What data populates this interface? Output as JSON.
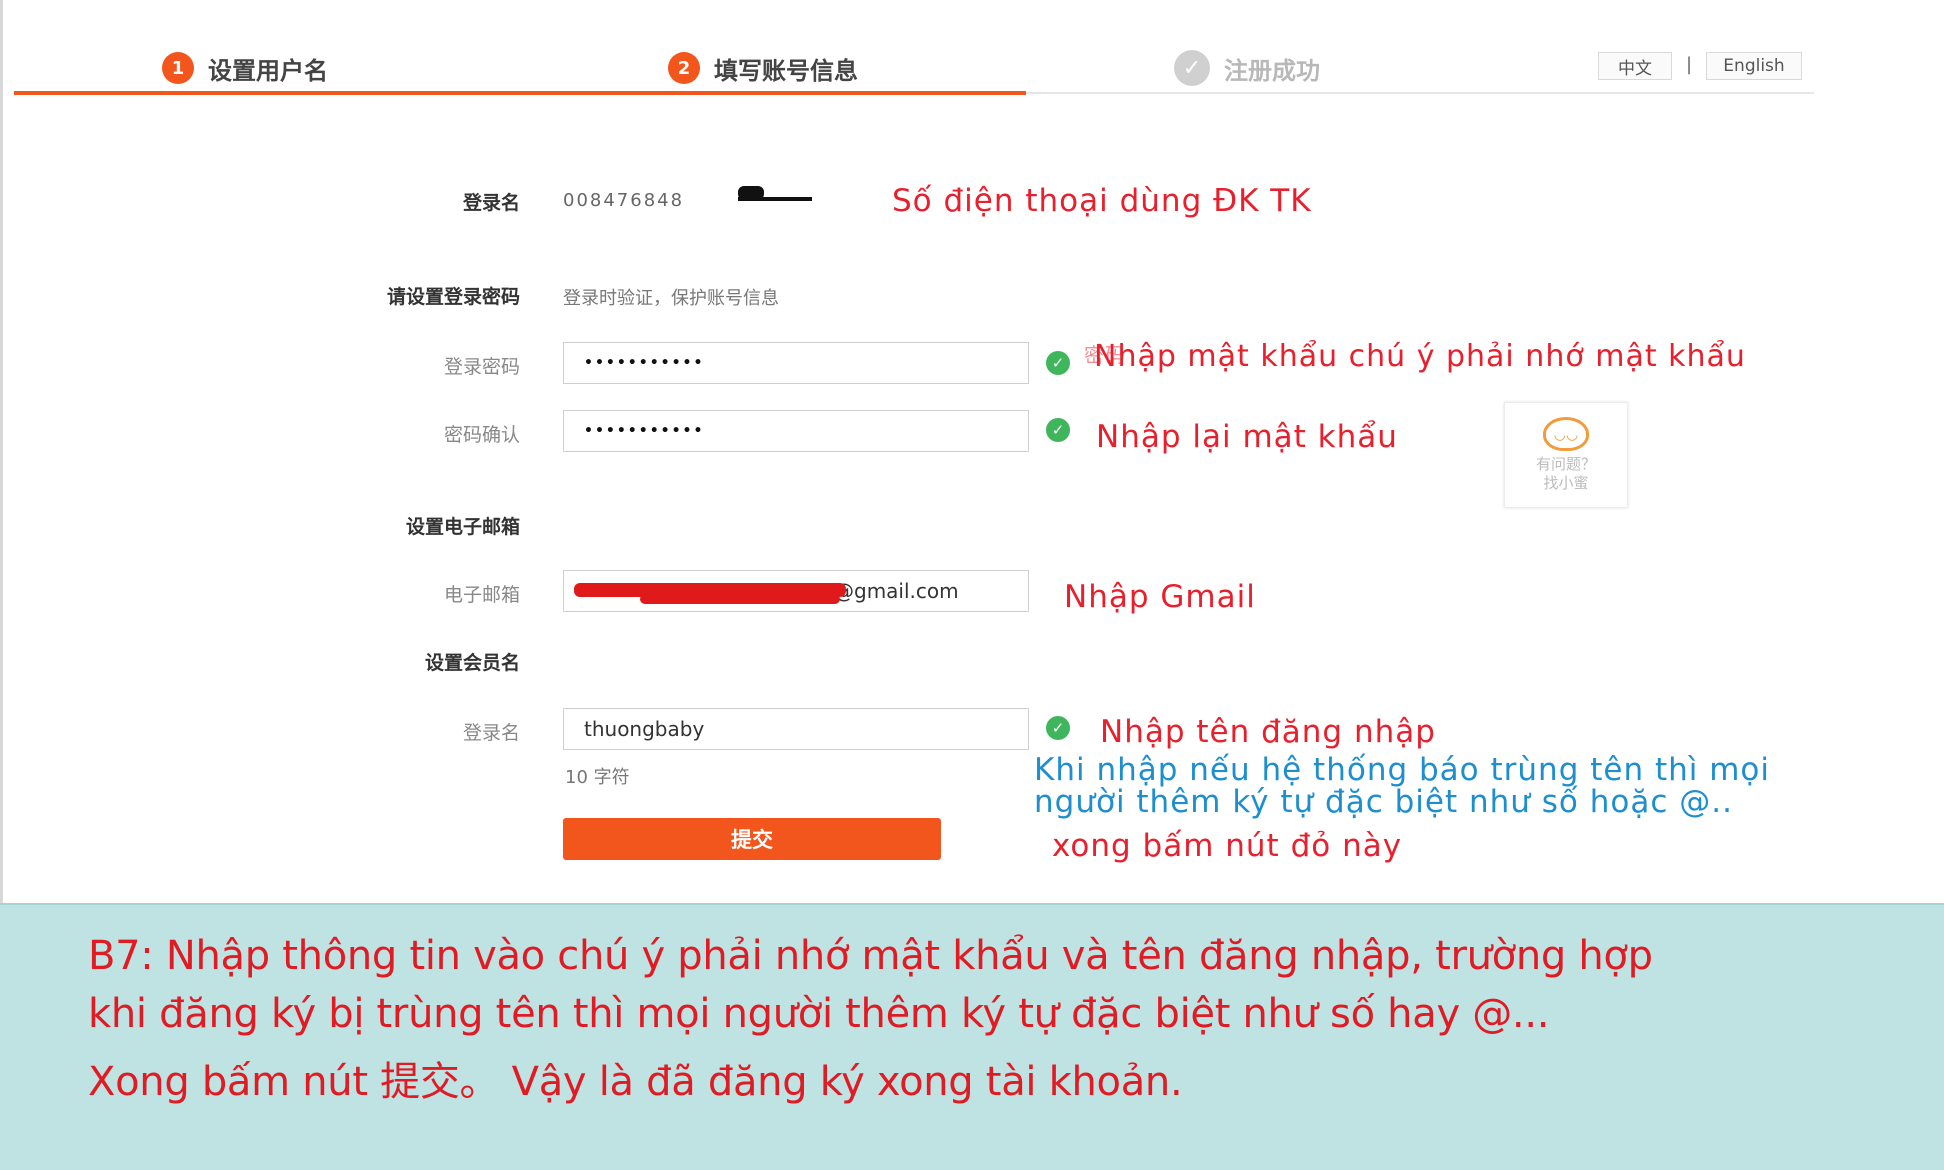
{
  "steps": [
    {
      "num": "1",
      "label": "设置用户名"
    },
    {
      "num": "2",
      "label": "填写账号信息"
    },
    {
      "label": "注册成功"
    }
  ],
  "lang": {
    "zh": "中文",
    "sep": "|",
    "en": "English"
  },
  "form": {
    "login_label": "登录名",
    "login_value": "008476848",
    "password_section": "请设置登录密码",
    "password_hint": "登录时验证，保护账号信息",
    "password_label": "登录密码",
    "password_value": "•••••••••••",
    "confirm_label": "密码确认",
    "confirm_value": "•••••••••••",
    "email_section": "设置电子邮箱",
    "email_label": "电子邮箱",
    "email_value": "@gmail.com",
    "member_section": "设置会员名",
    "member_label": "登录名",
    "member_value": "thuongbaby",
    "member_hint": "10 字符",
    "submit_label": "提交"
  },
  "helper": {
    "line1": "有问题？",
    "line2": "找小蜜"
  },
  "annotations": {
    "phone": "Số điện thoại dùng ĐK TK",
    "password_overlap": "密码",
    "password": "Nhập mật khẩu chú ý phải nhớ mật khẩu",
    "confirm": "Nhập lại mật khẩu",
    "gmail": "Nhập Gmail",
    "username": "Nhập tên đăng nhập",
    "duplicate_line1": "Khi nhập nếu hệ thống báo trùng tên thì mọi",
    "duplicate_line2": "người thêm ký tự đặc biệt như số hoặc @..",
    "press": "xong bấm nút đỏ này"
  },
  "caption": {
    "line1": "B7: Nhập thông tin vào chú ý phải nhớ mật khẩu và tên đăng nhập, trường hợp",
    "line2": "khi đăng ký bị trùng tên thì mọi người thêm ký tự đặc biệt như số hay @...",
    "line3": "Xong bấm nút 提交。 Vậy là đã đăng ký xong tài khoản."
  },
  "colors": {
    "accent": "#f2561d",
    "note_red": "#e8202e",
    "note_blue": "#1e8ecf",
    "caption_bg": "#bfe3e3",
    "ok_green": "#3fb65b"
  }
}
